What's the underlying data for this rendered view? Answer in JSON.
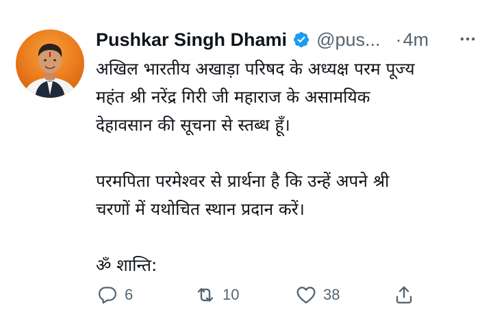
{
  "tweet": {
    "author": {
      "display_name": "Pushkar Singh Dhami",
      "handle": "@pus...",
      "verified": true
    },
    "separator": "·",
    "time": "4m",
    "body": {
      "para1_line1": "अखिल भारतीय अखाड़ा परिषद के अध्यक्ष परम पूज्य",
      "para1_line2": "महंत श्री नरेंद्र गिरी जी महाराज के असामयिक",
      "para1_line3": "देहावसान की सूचना से स्तब्ध हूँ।",
      "para2_line1": "परमपिता परमेश्वर से प्रार्थना है कि उन्हें अपने श्री",
      "para2_line2": "चरणों में यथोचित स्थान प्रदान करें।",
      "para3_line1": "ॐ शान्ति:"
    },
    "actions": {
      "reply_count": "6",
      "retweet_count": "10",
      "like_count": "38"
    }
  },
  "icons": {
    "verified": "verified-badge-icon",
    "more": "more-options-icon",
    "reply": "reply-icon",
    "retweet": "retweet-icon",
    "like": "like-icon",
    "share": "share-icon"
  },
  "colors": {
    "text": "#0f1419",
    "secondary": "#536471",
    "verified": "#1d9bf0",
    "avatar_bg": "#e8701c"
  }
}
